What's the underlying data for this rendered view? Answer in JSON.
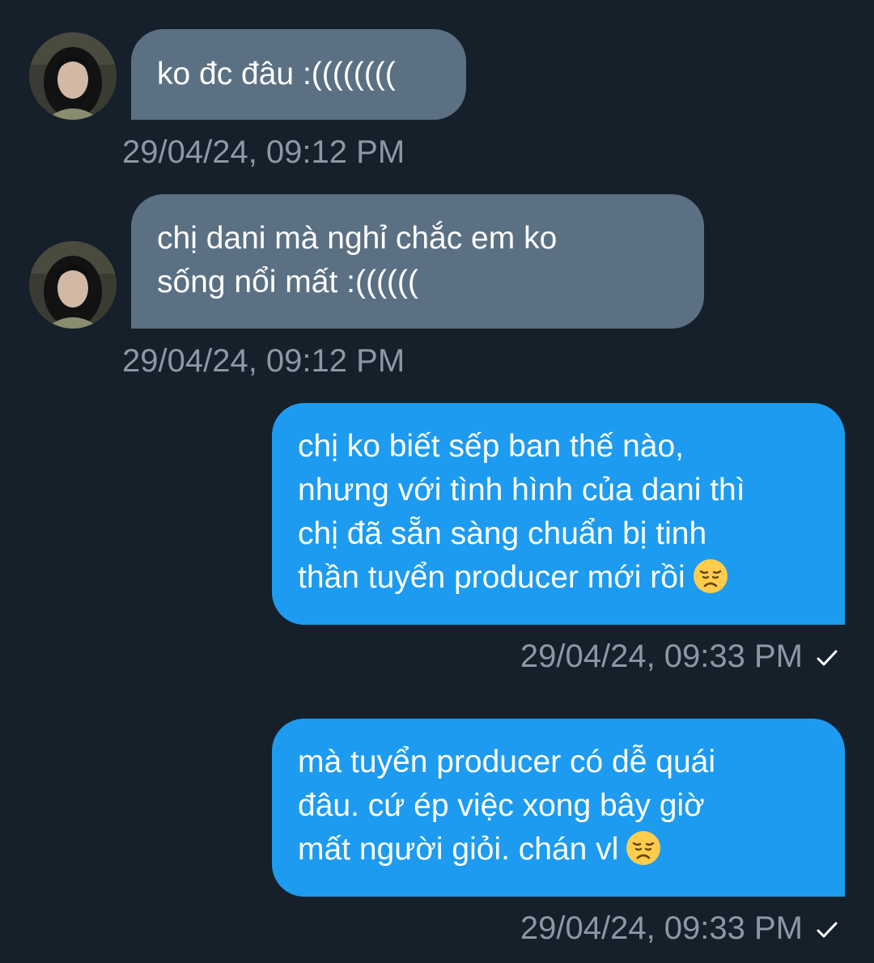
{
  "conversation": {
    "colors": {
      "background": "#15202b",
      "incoming_bubble": "#5b7083",
      "outgoing_bubble": "#1d9bf0",
      "timestamp": "#8b98a5"
    },
    "messages": [
      {
        "direction": "incoming",
        "lines": [
          "ko đc đâu :(((((((("
        ],
        "timestamp": "29/04/24, 09:12 PM"
      },
      {
        "direction": "incoming",
        "lines": [
          "chị dani mà nghỉ chắc em ko",
          "sống nổi mất :(((((("
        ],
        "timestamp": "29/04/24, 09:12 PM"
      },
      {
        "direction": "outgoing",
        "lines": [
          "chị ko biết sếp ban thế nào,",
          "nhưng với tình hình của dani thì",
          "chị đã sẵn sàng chuẩn bị tinh",
          "thần tuyển producer mới rồi"
        ],
        "emoji": "disappointed-face",
        "timestamp": "29/04/24, 09:33 PM",
        "status_icon": "sent-check-icon"
      },
      {
        "direction": "outgoing",
        "lines": [
          "mà tuyển producer có dễ quái",
          "đâu. cứ ép việc xong bây giờ",
          "mất người giỏi. chán vl"
        ],
        "emoji": "disappointed-face",
        "timestamp": "29/04/24, 09:33 PM",
        "status_icon": "sent-check-icon"
      }
    ]
  }
}
